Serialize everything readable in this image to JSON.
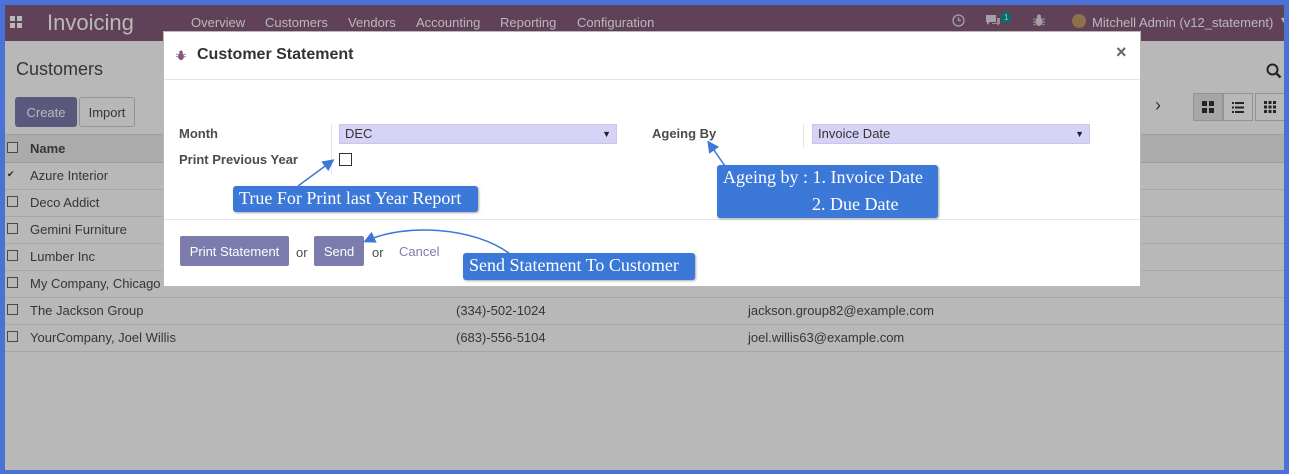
{
  "navbar": {
    "brand": "Invoicing",
    "menu": [
      "Overview",
      "Customers",
      "Vendors",
      "Accounting",
      "Reporting",
      "Configuration"
    ],
    "chat_badge": "1",
    "user": "Mitchell Admin (v12_statement)"
  },
  "control_panel": {
    "breadcrumb": "Customers",
    "create_label": "Create",
    "import_label": "Import"
  },
  "list": {
    "header_name": "Name",
    "rows": [
      {
        "name": "Azure Interior",
        "phone": "",
        "email": "",
        "checked": true
      },
      {
        "name": "Deco Addict",
        "phone": "",
        "email": "",
        "checked": false
      },
      {
        "name": "Gemini Furniture",
        "phone": "",
        "email": "",
        "checked": false
      },
      {
        "name": "Lumber Inc",
        "phone": "",
        "email": "",
        "checked": false
      },
      {
        "name": "My Company, Chicago",
        "phone": "",
        "email": "",
        "checked": false
      },
      {
        "name": "The Jackson Group",
        "phone": "(334)-502-1024",
        "email": "jackson.group82@example.com",
        "checked": false
      },
      {
        "name": "YourCompany, Joel Willis",
        "phone": "(683)-556-5104",
        "email": "joel.willis63@example.com",
        "checked": false
      }
    ]
  },
  "modal": {
    "title": "Customer Statement",
    "month_label": "Month",
    "month_value": "DEC",
    "print_prev_label": "Print Previous Year",
    "print_prev_checked": false,
    "ageing_label": "Ageing By",
    "ageing_value": "Invoice Date",
    "print_button": "Print Statement",
    "or_1": "or",
    "send_button": "Send",
    "or_2": "or",
    "cancel_button": "Cancel"
  },
  "annotations": {
    "print_prev_note": "True For Print last Year Report",
    "ageing_note_line1": "Ageing by : 1. Invoice Date",
    "ageing_note_line2": "2. Due Date",
    "send_note": "Send Statement To Customer"
  },
  "colors": {
    "navbar": "#875a7b",
    "primary_button": "#7c7bad",
    "callout": "#3b78d8",
    "frame_border": "#4a72d6",
    "select_bg": "#d6d3f7"
  }
}
